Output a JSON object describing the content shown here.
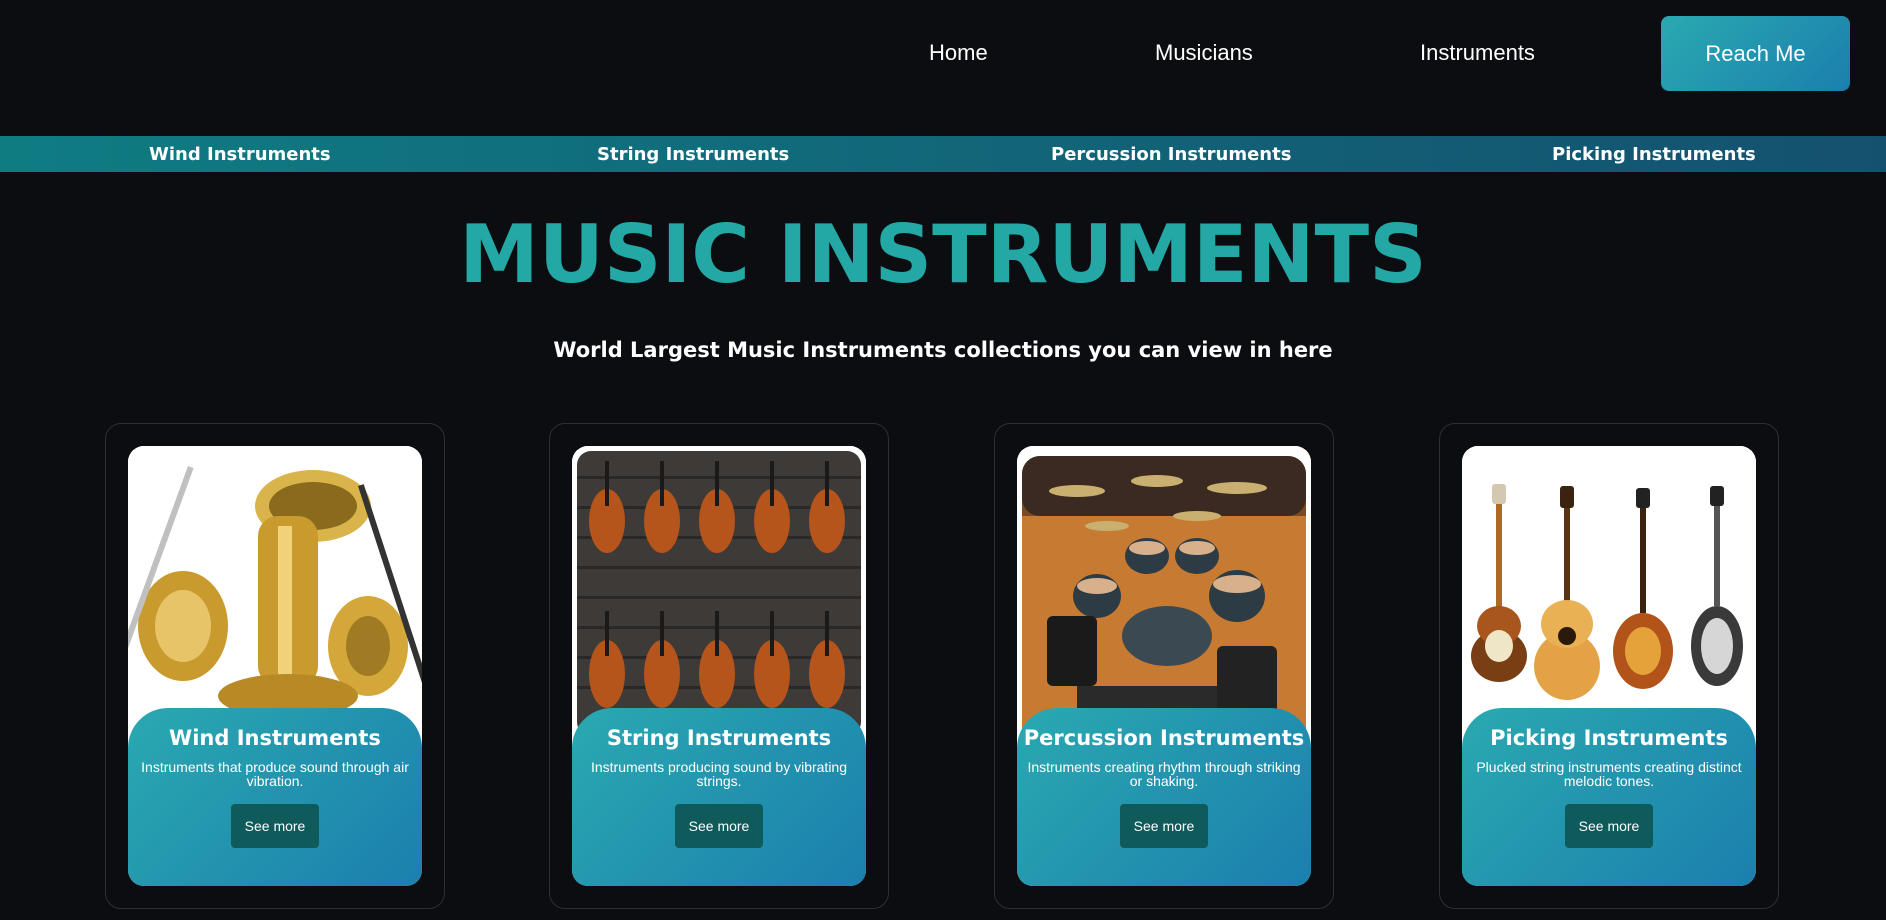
{
  "nav": {
    "links": [
      "Home",
      "Musicians",
      "Instruments"
    ],
    "cta": "Reach Me"
  },
  "subnav": [
    "Wind Instruments",
    "String Instruments",
    "Percussion Instruments",
    "Picking Instruments"
  ],
  "hero": {
    "title": "MUSIC INSTRUMENTS",
    "subtitle": "World Largest Music Instruments collections you can view in here"
  },
  "cards": [
    {
      "title": "Wind Instruments",
      "desc": "Instruments that produce sound through air vibration.",
      "button": "See more",
      "image": "brass-instruments-image"
    },
    {
      "title": "String Instruments",
      "desc": "Instruments producing sound by vibrating strings.",
      "button": "See more",
      "image": "violins-image"
    },
    {
      "title": "Percussion Instruments",
      "desc": "Instruments creating rhythm through striking or shaking.",
      "button": "See more",
      "image": "drum-kit-image"
    },
    {
      "title": "Picking Instruments",
      "desc": "Plucked string instruments creating distinct melodic tones.",
      "button": "See more",
      "image": "guitars-image"
    }
  ],
  "colors": {
    "background": "#0b0d11",
    "accent": "#24a8a5",
    "card_gradient_start": "#2aa9b0",
    "card_gradient_end": "#1b7fae",
    "button": "#0f5a5b"
  }
}
